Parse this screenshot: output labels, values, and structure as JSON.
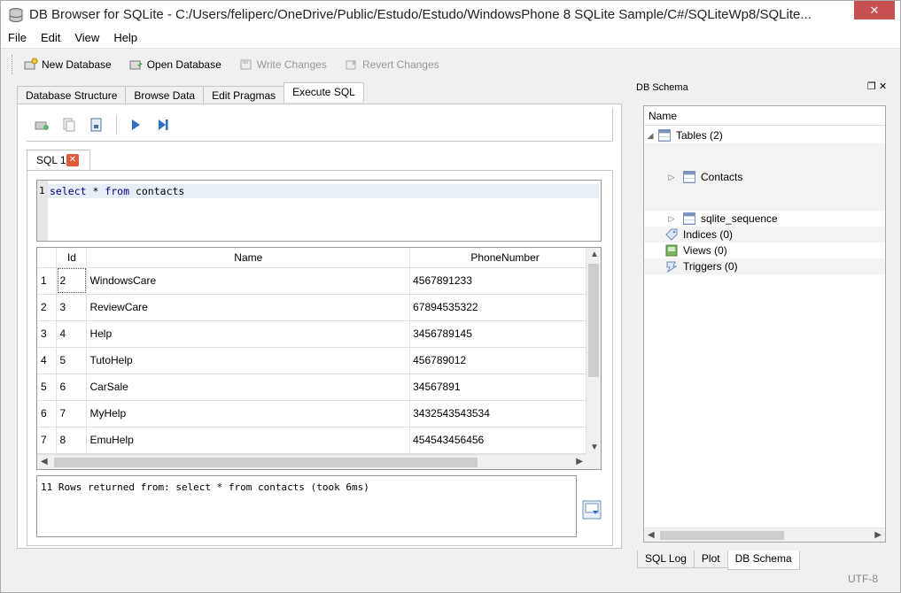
{
  "window": {
    "title": "DB Browser for SQLite - C:/Users/feliperc/OneDrive/Public/Estudo/Estudo/WindowsPhone 8 SQLite Sample/C#/SQLiteWp8/SQLite..."
  },
  "menu": [
    "File",
    "Edit",
    "View",
    "Help"
  ],
  "toolbar": {
    "new_database": "New Database",
    "open_database": "Open Database",
    "write_changes": "Write Changes",
    "revert_changes": "Revert Changes"
  },
  "tabs": [
    "Database Structure",
    "Browse Data",
    "Edit Pragmas",
    "Execute SQL"
  ],
  "active_tab": "Execute SQL",
  "sql_tab": {
    "label": "SQL 1"
  },
  "editor": {
    "line_number": "1",
    "kw1": "select",
    "mid1": " * ",
    "kw2": "from",
    "rest": " contacts"
  },
  "results": {
    "columns": [
      "Id",
      "Name",
      "PhoneNumber"
    ],
    "rows": [
      {
        "n": "1",
        "id": "2",
        "name": "WindowsCare",
        "phone": "4567891233"
      },
      {
        "n": "2",
        "id": "3",
        "name": "ReviewCare",
        "phone": "67894535322"
      },
      {
        "n": "3",
        "id": "4",
        "name": "Help",
        "phone": "3456789145"
      },
      {
        "n": "4",
        "id": "5",
        "name": "TutoHelp",
        "phone": "456789012"
      },
      {
        "n": "5",
        "id": "6",
        "name": "CarSale",
        "phone": "34567891"
      },
      {
        "n": "6",
        "id": "7",
        "name": "MyHelp",
        "phone": "3432543543534"
      },
      {
        "n": "7",
        "id": "8",
        "name": "EmuHelp",
        "phone": "454543456456"
      }
    ]
  },
  "status_message": "11 Rows returned from: select * from contacts (took 6ms)",
  "dock": {
    "title": "DB Schema",
    "header": "Name",
    "tables_label": "Tables (2)",
    "contacts": "Contacts",
    "sqlite_sequence": "sqlite_sequence",
    "indices": "Indices (0)",
    "views": "Views (0)",
    "triggers": "Triggers (0)"
  },
  "bottom_tabs": [
    "SQL Log",
    "Plot",
    "DB Schema"
  ],
  "encoding": "UTF-8"
}
